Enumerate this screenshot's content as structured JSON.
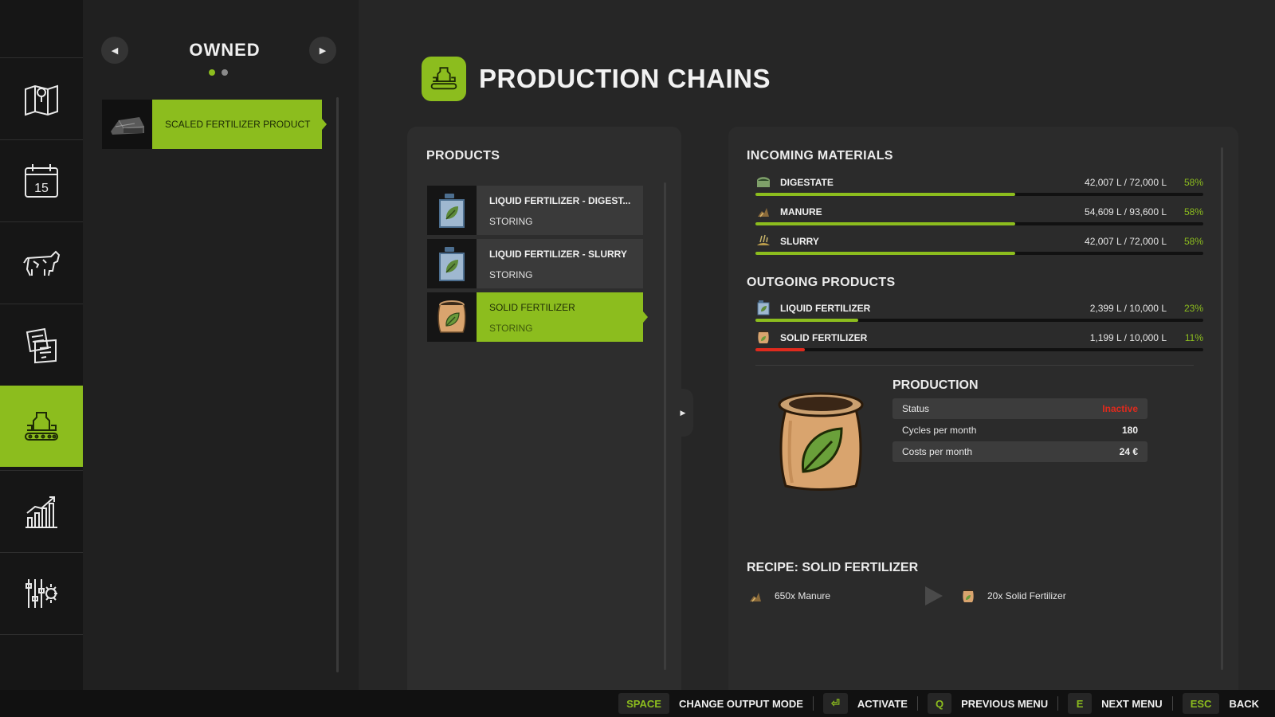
{
  "nav": {
    "items": [
      {
        "icon": "map-icon"
      },
      {
        "icon": "calendar-icon",
        "badge": "15"
      },
      {
        "icon": "cow-icon"
      },
      {
        "icon": "contracts-icon"
      },
      {
        "icon": "production-icon",
        "active": true
      },
      {
        "icon": "statistics-icon"
      },
      {
        "icon": "settings-icon"
      }
    ]
  },
  "owned": {
    "title": "OWNED",
    "page": 1,
    "page_count": 2,
    "entries": [
      {
        "label": "SCALED FERTILIZER PRODUCT",
        "selected": true
      }
    ]
  },
  "header": {
    "title": "PRODUCTION CHAINS"
  },
  "products": {
    "heading": "PRODUCTS",
    "items": [
      {
        "name": "LIQUID FERTILIZER - DIGEST...",
        "status": "STORING",
        "icon": "liquid-fertilizer-icon"
      },
      {
        "name": "LIQUID FERTILIZER - SLURRY",
        "status": "STORING",
        "icon": "liquid-fertilizer-icon"
      },
      {
        "name": "SOLID FERTILIZER",
        "status": "STORING",
        "icon": "solid-fertilizer-icon",
        "selected": true
      }
    ]
  },
  "incoming": {
    "heading": "INCOMING MATERIALS",
    "items": [
      {
        "name": "DIGESTATE",
        "amount": "42,007 L / 72,000 L",
        "percent": "58%",
        "fill": 0.58,
        "icon": "digestate-icon"
      },
      {
        "name": "MANURE",
        "amount": "54,609 L / 93,600 L",
        "percent": "58%",
        "fill": 0.58,
        "icon": "manure-icon"
      },
      {
        "name": "SLURRY",
        "amount": "42,007 L / 72,000 L",
        "percent": "58%",
        "fill": 0.58,
        "icon": "slurry-icon"
      }
    ]
  },
  "outgoing": {
    "heading": "OUTGOING PRODUCTS",
    "items": [
      {
        "name": "LIQUID FERTILIZER",
        "amount": "2,399 L / 10,000 L",
        "percent": "23%",
        "fill": 0.23,
        "icon": "liquid-fertilizer-icon"
      },
      {
        "name": "SOLID FERTILIZER",
        "amount": "1,199 L / 10,000 L",
        "percent": "11%",
        "fill": 0.11,
        "icon": "solid-fertilizer-icon",
        "low": true
      }
    ]
  },
  "production": {
    "heading": "PRODUCTION",
    "stats": [
      {
        "label": "Status",
        "value": "Inactive",
        "status_color": "#e02a1d"
      },
      {
        "label": "Cycles per month",
        "value": "180"
      },
      {
        "label": "Costs per month",
        "value": "24 €"
      }
    ]
  },
  "recipe": {
    "heading": "RECIPE: SOLID FERTILIZER",
    "input": "650x Manure",
    "output": "20x Solid Fertilizer"
  },
  "bottom_bar": {
    "hints": [
      {
        "key": "SPACE",
        "label": "CHANGE OUTPUT MODE"
      },
      {
        "key": "⏎",
        "label": "ACTIVATE"
      },
      {
        "key": "Q",
        "label": "PREVIOUS MENU"
      },
      {
        "key": "E",
        "label": "NEXT MENU"
      },
      {
        "key": "ESC",
        "label": "BACK"
      }
    ]
  },
  "colors": {
    "accent": "#8cbd1e",
    "background": "#262626",
    "warning": "#e02a1d"
  }
}
